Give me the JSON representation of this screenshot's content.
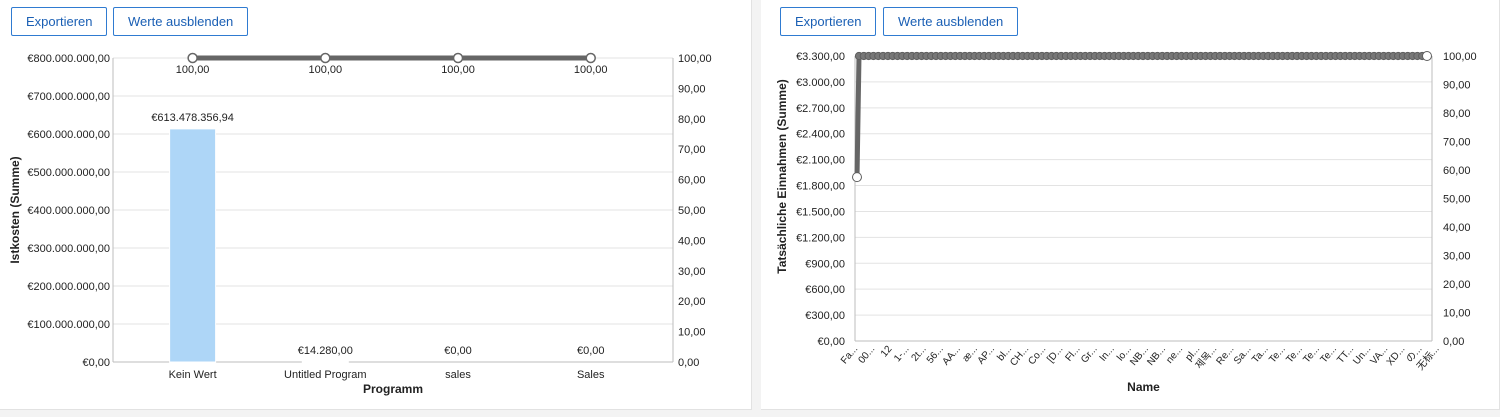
{
  "toolbar": {
    "export_label": "Exportieren",
    "hide_values_label": "Werte ausblenden"
  },
  "colors": {
    "bar": "#aed6f7",
    "line": "#666666",
    "grid": "#e3e3e3",
    "button_border": "#2f7bd1",
    "button_text": "#1a5fb4"
  },
  "chart_data": [
    {
      "type": "bar",
      "xlabel": "Programm",
      "ylabel": "Istkosten (Summe)",
      "categories": [
        "Kein Wert",
        "Untitled Program",
        "sales",
        "Sales"
      ],
      "values": [
        613478356.94,
        14280,
        0,
        0
      ],
      "value_labels": [
        "€613.478.356,94",
        "€14.280,00",
        "€0,00",
        "€0,00"
      ],
      "ylim": [
        0,
        800000000
      ],
      "y_ticks": [
        "€0,00",
        "€100.000.000,00",
        "€200.000.000,00",
        "€300.000.000,00",
        "€400.000.000,00",
        "€500.000.000,00",
        "€600.000.000,00",
        "€700.000.000,00",
        "€800.000.000,00"
      ],
      "line_series": {
        "values": [
          100,
          100,
          100,
          100
        ],
        "labels": [
          "100,00",
          "100,00",
          "100,00",
          "100,00"
        ]
      },
      "y2lim": [
        0,
        100
      ],
      "y2_ticks": [
        "0,00",
        "10,00",
        "20,00",
        "30,00",
        "40,00",
        "50,00",
        "60,00",
        "70,00",
        "80,00",
        "90,00",
        "100,00"
      ],
      "grid": true
    },
    {
      "type": "line",
      "xlabel": "Name",
      "ylabel": "Tatsächliche Einnahmen (Summe)",
      "categories": [
        "Fa...",
        "00...",
        "12",
        "1-...",
        "2t...",
        "56...",
        "AA...",
        "æ...",
        "AP...",
        "bl...",
        "CH...",
        "Co...",
        "[D...",
        "Fl...",
        "Gr...",
        "In...",
        "lo...",
        "NB...",
        "NB...",
        "ne...",
        "pl...",
        "제목...",
        "Re...",
        "Sa...",
        "Ta...",
        "Te...",
        "Te...",
        "Te...",
        "Te...",
        "TT...",
        "Un...",
        "VA...",
        "XD...",
        "の...",
        "无标..."
      ],
      "ylim": [
        0,
        3300
      ],
      "y_ticks": [
        "€0,00",
        "€300,00",
        "€600,00",
        "€900,00",
        "€1.200,00",
        "€1.500,00",
        "€1.800,00",
        "€2.100,00",
        "€2.400,00",
        "€2.700,00",
        "€3.000,00",
        "€3.300,00"
      ],
      "line_series": {
        "first_value": 57.5,
        "rest_value": 100,
        "point_count": 120
      },
      "y2lim": [
        0,
        100
      ],
      "y2_ticks": [
        "0,00",
        "10,00",
        "20,00",
        "30,00",
        "40,00",
        "50,00",
        "60,00",
        "70,00",
        "80,00",
        "90,00",
        "100,00"
      ],
      "grid": true
    }
  ]
}
